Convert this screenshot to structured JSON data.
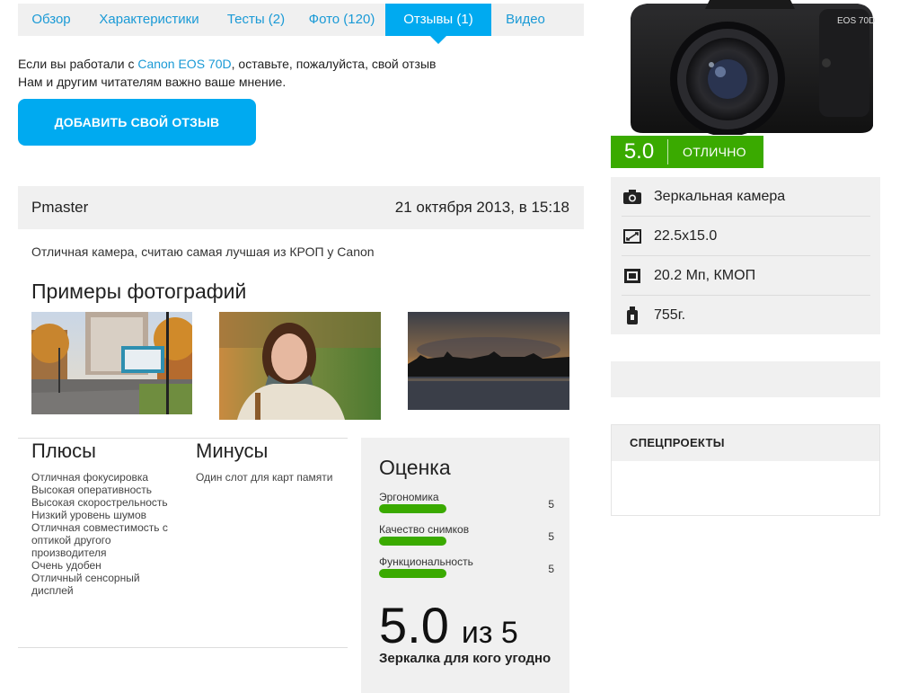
{
  "tabs": [
    {
      "label": "Обзор",
      "active": false
    },
    {
      "label": "Характеристики",
      "active": false
    },
    {
      "label": "Тесты (2)",
      "active": false
    },
    {
      "label": "Фото (120)",
      "active": false
    },
    {
      "label": "Отзывы (1)",
      "active": true
    },
    {
      "label": "Видео",
      "active": false
    }
  ],
  "intro": {
    "line1_prefix": "Если вы работали с ",
    "camera_link": "Canon EOS 70D",
    "line1_suffix": ", оставьте, пожалуйста, свой отзыв",
    "line2": "Нам и другим читателям важно ваше мнение."
  },
  "add_review_button": "ДОБАВИТЬ СВОЙ ОТЗЫВ",
  "review": {
    "author": "Pmaster",
    "date": "21 октября 2013, в 15:18",
    "text": "Отличная камера, считаю самая лучшая из КРОП у Canon",
    "photos_title": "Примеры фотографий",
    "pros_title": "Плюсы",
    "pros": [
      "Отличная фокусировка",
      "Высокая оперативность",
      "Высокая скорострельность",
      "Низкий уровень шумов",
      "Отличная совместимость с оптикой другого производителя",
      "Очень удобен",
      "Отличный сенсорный дисплей"
    ],
    "cons_title": "Минусы",
    "cons": [
      "Один слот для карт памяти"
    ],
    "rating": {
      "title": "Оценка",
      "metrics": [
        {
          "label": "Эргономика",
          "value": "5",
          "fraction": 1.0
        },
        {
          "label": "Качество снимков",
          "value": "5",
          "fraction": 1.0
        },
        {
          "label": "Функциональность",
          "value": "5",
          "fraction": 1.0
        }
      ],
      "score": "5.0",
      "out_of": "из 5",
      "verdict": "Зеркалка для кого угодно"
    }
  },
  "sidebar": {
    "camera_model_text": "EOS 70D",
    "score_value": "5.0",
    "score_label": "ОТЛИЧНО",
    "specs": [
      {
        "icon": "camera-icon",
        "text": "Зеркальная камера"
      },
      {
        "icon": "sensor-size-icon",
        "text": "22.5x15.0"
      },
      {
        "icon": "sensor-chip-icon",
        "text": "20.2 Мп, КМОП"
      },
      {
        "icon": "weight-icon",
        "text": "755г."
      }
    ],
    "special_projects_title": "СПЕЦПРОЕКТЫ"
  },
  "colors": {
    "accent_blue": "#00aaf0",
    "link_blue": "#1a9ad6",
    "score_green": "#3aaa00",
    "panel_gray": "#f0f0f0"
  }
}
